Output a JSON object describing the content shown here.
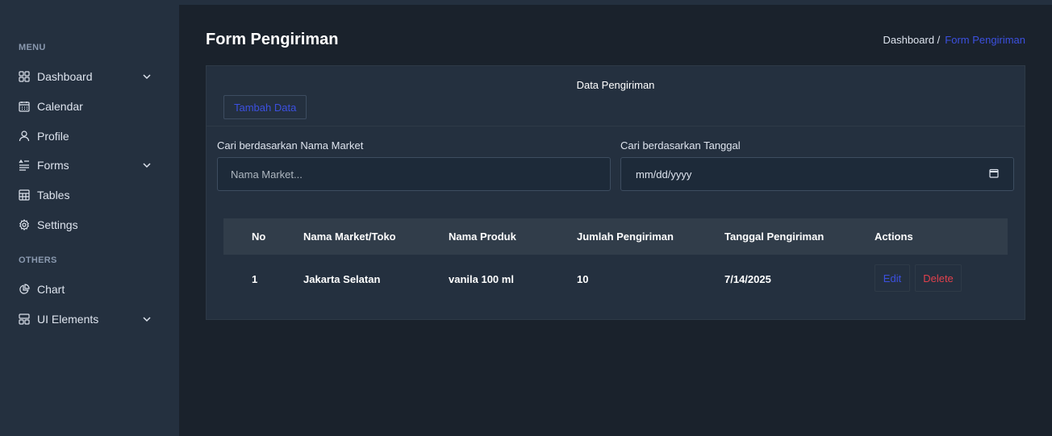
{
  "sidebar": {
    "menu_heading": "MENU",
    "others_heading": "OTHERS",
    "items": [
      {
        "label": "Dashboard",
        "icon": "grid-icon",
        "has_chevron": true
      },
      {
        "label": "Calendar",
        "icon": "calendar-icon",
        "has_chevron": false
      },
      {
        "label": "Profile",
        "icon": "user-icon",
        "has_chevron": false
      },
      {
        "label": "Forms",
        "icon": "forms-icon",
        "has_chevron": true
      },
      {
        "label": "Tables",
        "icon": "table-icon",
        "has_chevron": false
      },
      {
        "label": "Settings",
        "icon": "gear-icon",
        "has_chevron": false
      }
    ],
    "other_items": [
      {
        "label": "Chart",
        "icon": "pie-chart-icon",
        "has_chevron": false
      },
      {
        "label": "UI Elements",
        "icon": "layout-icon",
        "has_chevron": true
      }
    ]
  },
  "page": {
    "title": "Form Pengiriman",
    "breadcrumb": {
      "parent": "Dashboard /",
      "current": "Form Pengiriman"
    }
  },
  "card": {
    "title": "Data Pengiriman",
    "add_button": "Tambah Data"
  },
  "filters": {
    "market_label": "Cari berdasarkan Nama Market",
    "market_placeholder": "Nama Market...",
    "date_label": "Cari berdasarkan Tanggal",
    "date_value": "mm/dd/yyyy"
  },
  "table": {
    "headers": [
      "No",
      "Nama Market/Toko",
      "Nama Produk",
      "Jumlah Pengiriman",
      "Tanggal Pengiriman",
      "Actions"
    ],
    "rows": [
      {
        "no": "1",
        "market": "Jakarta Selatan",
        "produk": "vanila 100 ml",
        "jumlah": "10",
        "tanggal": "7/14/2025",
        "edit": "Edit",
        "delete": "Delete"
      }
    ]
  },
  "colors": {
    "background": "#1a222c",
    "sidebar": "#24303f",
    "accent": "#3c50e0",
    "danger": "#e0404c"
  }
}
